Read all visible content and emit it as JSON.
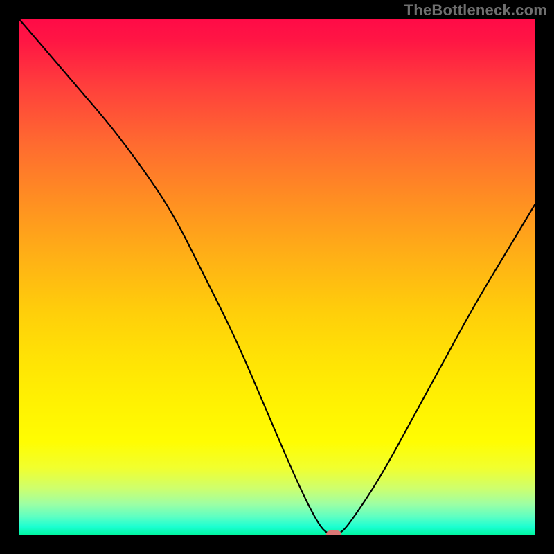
{
  "watermark": "TheBottleneck.com",
  "colors": {
    "frame": "#000000",
    "watermark_text": "#6f6f6f",
    "curve": "#000000",
    "marker": "#db7876",
    "gradient_top": "#ff0b47",
    "gradient_bottom": "#00f7a1"
  },
  "chart_data": {
    "type": "line",
    "title": "",
    "xlabel": "",
    "ylabel": "",
    "xlim": [
      0,
      100
    ],
    "ylim": [
      0,
      100
    ],
    "grid": false,
    "legend": false,
    "background": "vertical-spectral-gradient",
    "series": [
      {
        "name": "bottleneck-curve",
        "x": [
          0,
          6,
          12,
          18,
          24,
          30,
          36,
          42,
          48,
          54,
          58,
          60,
          62,
          64,
          70,
          76,
          82,
          88,
          94,
          100
        ],
        "values": [
          100,
          93,
          86,
          79,
          71,
          62,
          50,
          38,
          24,
          10,
          2,
          0,
          0,
          2,
          11,
          22,
          33,
          44,
          54,
          64
        ]
      }
    ],
    "annotations": [
      {
        "name": "optimum-marker",
        "x": 61,
        "y": 0,
        "shape": "pill",
        "color": "#db7876"
      }
    ]
  }
}
